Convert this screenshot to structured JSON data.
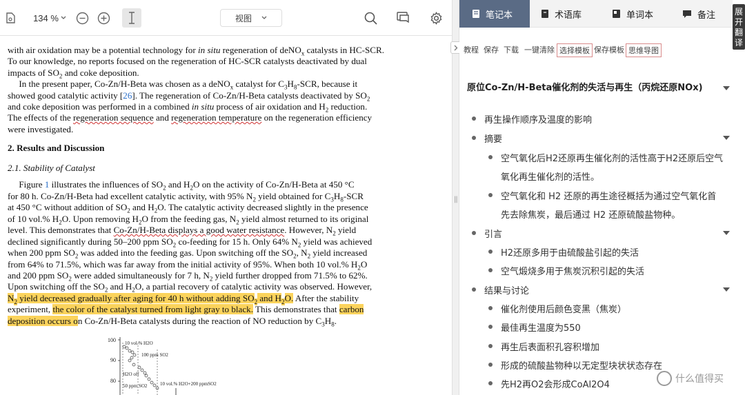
{
  "toolbar": {
    "zoom": "134 %",
    "view_label": "视图"
  },
  "pdf": {
    "lines": [
      [
        {
          "t": "with air oxidation may be a potential technology for "
        },
        {
          "t": "in situ",
          "c": "i"
        },
        {
          "t": " regeneration of deNO"
        },
        {
          "t": "x",
          "c": "sub"
        },
        {
          "t": " catalysts in HC-SCR."
        }
      ],
      [
        {
          "t": "To our knowledge, no reports focused on the regeneration of HC-SCR catalysts deactivated by dual"
        }
      ],
      [
        {
          "t": "impacts of SO"
        },
        {
          "t": "2",
          "c": "sub"
        },
        {
          "t": " and coke deposition."
        }
      ],
      [
        {
          "t": "     In the present paper, Co-Zn/H-Beta was chosen as a deNO"
        },
        {
          "t": "x",
          "c": "sub"
        },
        {
          "t": " catalyst for C"
        },
        {
          "t": "3",
          "c": "sub"
        },
        {
          "t": "H"
        },
        {
          "t": "8",
          "c": "sub"
        },
        {
          "t": "-SCR, because it"
        }
      ],
      [
        {
          "t": "showed good catalytic activity ["
        },
        {
          "t": "26",
          "c": "link"
        },
        {
          "t": "]. The regeneration of Co-Zn/H-Beta catalysts deactivated by SO"
        },
        {
          "t": "2",
          "c": "sub"
        }
      ],
      [
        {
          "t": "and coke deposition was performed in a combined "
        },
        {
          "t": "in situ",
          "c": "i"
        },
        {
          "t": " process of air oxidation and H"
        },
        {
          "t": "2",
          "c": "sub"
        },
        {
          "t": " reduction."
        }
      ],
      [
        {
          "t": "The effects of the "
        },
        {
          "t": "regeneration sequence",
          "c": "wav"
        },
        {
          "t": " and "
        },
        {
          "t": "regeneration temperature",
          "c": "wav"
        },
        {
          "t": " on the regeneration efficiency"
        }
      ],
      [
        {
          "t": "were investigated."
        }
      ],
      [
        {
          "t": "2. Results and Discussion",
          "c": "b"
        }
      ],
      [
        {
          "t": "2.1. Stability of Catalyst",
          "c": "i"
        }
      ],
      [
        {
          "t": "     Figure "
        },
        {
          "t": "1",
          "c": "link"
        },
        {
          "t": " illustrates the influences of SO"
        },
        {
          "t": "2",
          "c": "sub"
        },
        {
          "t": " and H"
        },
        {
          "t": "2",
          "c": "sub"
        },
        {
          "t": "O on the activity of Co-Zn/H-Beta at 450 °C"
        }
      ],
      [
        {
          "t": "for 80 h.  Co-Zn/H-Beta had excellent catalytic activity, with 95% N"
        },
        {
          "t": "2",
          "c": "sub"
        },
        {
          "t": " yield obtained for C"
        },
        {
          "t": "3",
          "c": "sub"
        },
        {
          "t": "H"
        },
        {
          "t": "8",
          "c": "sub"
        },
        {
          "t": "-SCR"
        }
      ],
      [
        {
          "t": "at 450 °C without addition of SO"
        },
        {
          "t": "2",
          "c": "sub"
        },
        {
          "t": " and H"
        },
        {
          "t": "2",
          "c": "sub"
        },
        {
          "t": "O. The catalytic activity decreased slightly in the presence"
        }
      ],
      [
        {
          "t": "of 10 vol.% H"
        },
        {
          "t": "2",
          "c": "sub"
        },
        {
          "t": "O. Upon removing H"
        },
        {
          "t": "2",
          "c": "sub"
        },
        {
          "t": "O from the feeding gas, N"
        },
        {
          "t": "2",
          "c": "sub"
        },
        {
          "t": " yield almost returned to its original"
        }
      ],
      [
        {
          "t": "level.  This demonstrates that "
        },
        {
          "t": "Co-Zn/H-Beta displays a good water resistance",
          "c": "wav"
        },
        {
          "t": ".  However, N"
        },
        {
          "t": "2",
          "c": "sub"
        },
        {
          "t": " yield"
        }
      ],
      [
        {
          "t": "declined significantly during 50–200 ppm SO"
        },
        {
          "t": "2",
          "c": "sub"
        },
        {
          "t": " co-feeding for 15 h. Only 64% N"
        },
        {
          "t": "2",
          "c": "sub"
        },
        {
          "t": " yield was achieved"
        }
      ],
      [
        {
          "t": "when 200 ppm SO"
        },
        {
          "t": "2",
          "c": "sub"
        },
        {
          "t": " was added into the feeding gas. Upon switching off the SO"
        },
        {
          "t": "2",
          "c": "sub"
        },
        {
          "t": ", N"
        },
        {
          "t": "2",
          "c": "sub"
        },
        {
          "t": " yield increased"
        }
      ],
      [
        {
          "t": "from 64% to 71.5%, which was far away from the initial activity of 95%.  When both 10 vol.% H"
        },
        {
          "t": "2",
          "c": "sub"
        },
        {
          "t": "O"
        }
      ],
      [
        {
          "t": "and 200 ppm SO"
        },
        {
          "t": "2",
          "c": "sub"
        },
        {
          "t": " were added simultaneously for 7 h, N"
        },
        {
          "t": "2",
          "c": "sub"
        },
        {
          "t": " yield further dropped from 71.5% to 62%."
        }
      ],
      [
        {
          "t": "Upon switching off the SO"
        },
        {
          "t": "2",
          "c": "sub"
        },
        {
          "t": " and H"
        },
        {
          "t": "2",
          "c": "sub"
        },
        {
          "t": "O, a partial recovery of catalytic activity was observed. However,"
        }
      ],
      [
        {
          "t": "N",
          "c": "hl"
        },
        {
          "t": "2",
          "c": "hlsub"
        },
        {
          "t": " yield decreased gradually after aging for 40 h without adding SO",
          "c": "hl"
        },
        {
          "t": "2",
          "c": "hlsub"
        },
        {
          "t": " and H",
          "c": "hl"
        },
        {
          "t": "2",
          "c": "hlsub"
        },
        {
          "t": "O.",
          "c": "hl"
        },
        {
          "t": " After the stability"
        }
      ],
      [
        {
          "t": "experiment, "
        },
        {
          "t": "the color of the catalyst turned from light gray to black.",
          "c": "hl"
        },
        {
          "t": " This demonstrates that "
        },
        {
          "t": "carbon",
          "c": "hl"
        }
      ],
      [
        {
          "t": "deposition occurs o",
          "c": "hl"
        },
        {
          "t": "n Co-Zn/H-Beta catalysts during the reaction of NO reduction by C"
        },
        {
          "t": "3",
          "c": "sub"
        },
        {
          "t": "H"
        },
        {
          "t": "8",
          "c": "sub"
        },
        {
          "t": "."
        }
      ]
    ],
    "figure": {
      "y_ticks": [
        "100",
        "90",
        "80"
      ],
      "labels": [
        "10 vol.% H2O",
        "100 ppm SO2",
        "H2O off",
        "50 ppm SO2",
        "10 vol.% H2O+200 ppmSO2"
      ]
    }
  },
  "notes": {
    "tabs": [
      {
        "label": "笔记本",
        "icon": "notebook-icon"
      },
      {
        "label": "术语库",
        "icon": "glossary-icon"
      },
      {
        "label": "单词本",
        "icon": "wordbook-icon"
      },
      {
        "label": "备注",
        "icon": "comment-icon"
      }
    ],
    "actions": [
      "教程",
      "保存",
      "下载",
      "一键清除",
      "选择模板",
      "保存模板",
      "思维导图"
    ],
    "title": "原位Co-Zn/H-Beta催化剂的失活与再生（丙烷还原NOx)",
    "items": [
      {
        "level": 1,
        "text": "再生操作顺序及温度的影响",
        "expand": false
      },
      {
        "level": 1,
        "text": "摘要",
        "expand": true
      },
      {
        "level": 2,
        "text": "空气氧化后H2还原再生催化剂的活性高于H2还原后空气"
      },
      {
        "level": 3,
        "text": "氧化再生催化剂的活性。"
      },
      {
        "level": 2,
        "text": "空气氧化和 H2 还原的再生途径概括为通过空气氧化首"
      },
      {
        "level": 3,
        "text": "先去除焦炭，最后通过 H2 还原硫酸盐物种。"
      },
      {
        "level": 1,
        "text": "引言",
        "expand": true
      },
      {
        "level": 2,
        "text": "H2还原多用于由硫酸盐引起的失活"
      },
      {
        "level": 2,
        "text": "空气煅烧多用于焦炭沉积引起的失活"
      },
      {
        "level": 1,
        "text": "结果与讨论",
        "expand": true
      },
      {
        "level": 2,
        "text": "催化剂使用后颜色变黑（焦炭）"
      },
      {
        "level": 2,
        "text": "最佳再生温度为550"
      },
      {
        "level": 2,
        "text": "再生后表面积孔容积增加"
      },
      {
        "level": 2,
        "text": "形成的硫酸盐物种以无定型块状状态存在"
      },
      {
        "level": 2,
        "text": "先H2再O2会形成CoAl2O4"
      }
    ]
  },
  "side_button": "展开翻译",
  "watermark": "什么值得买"
}
